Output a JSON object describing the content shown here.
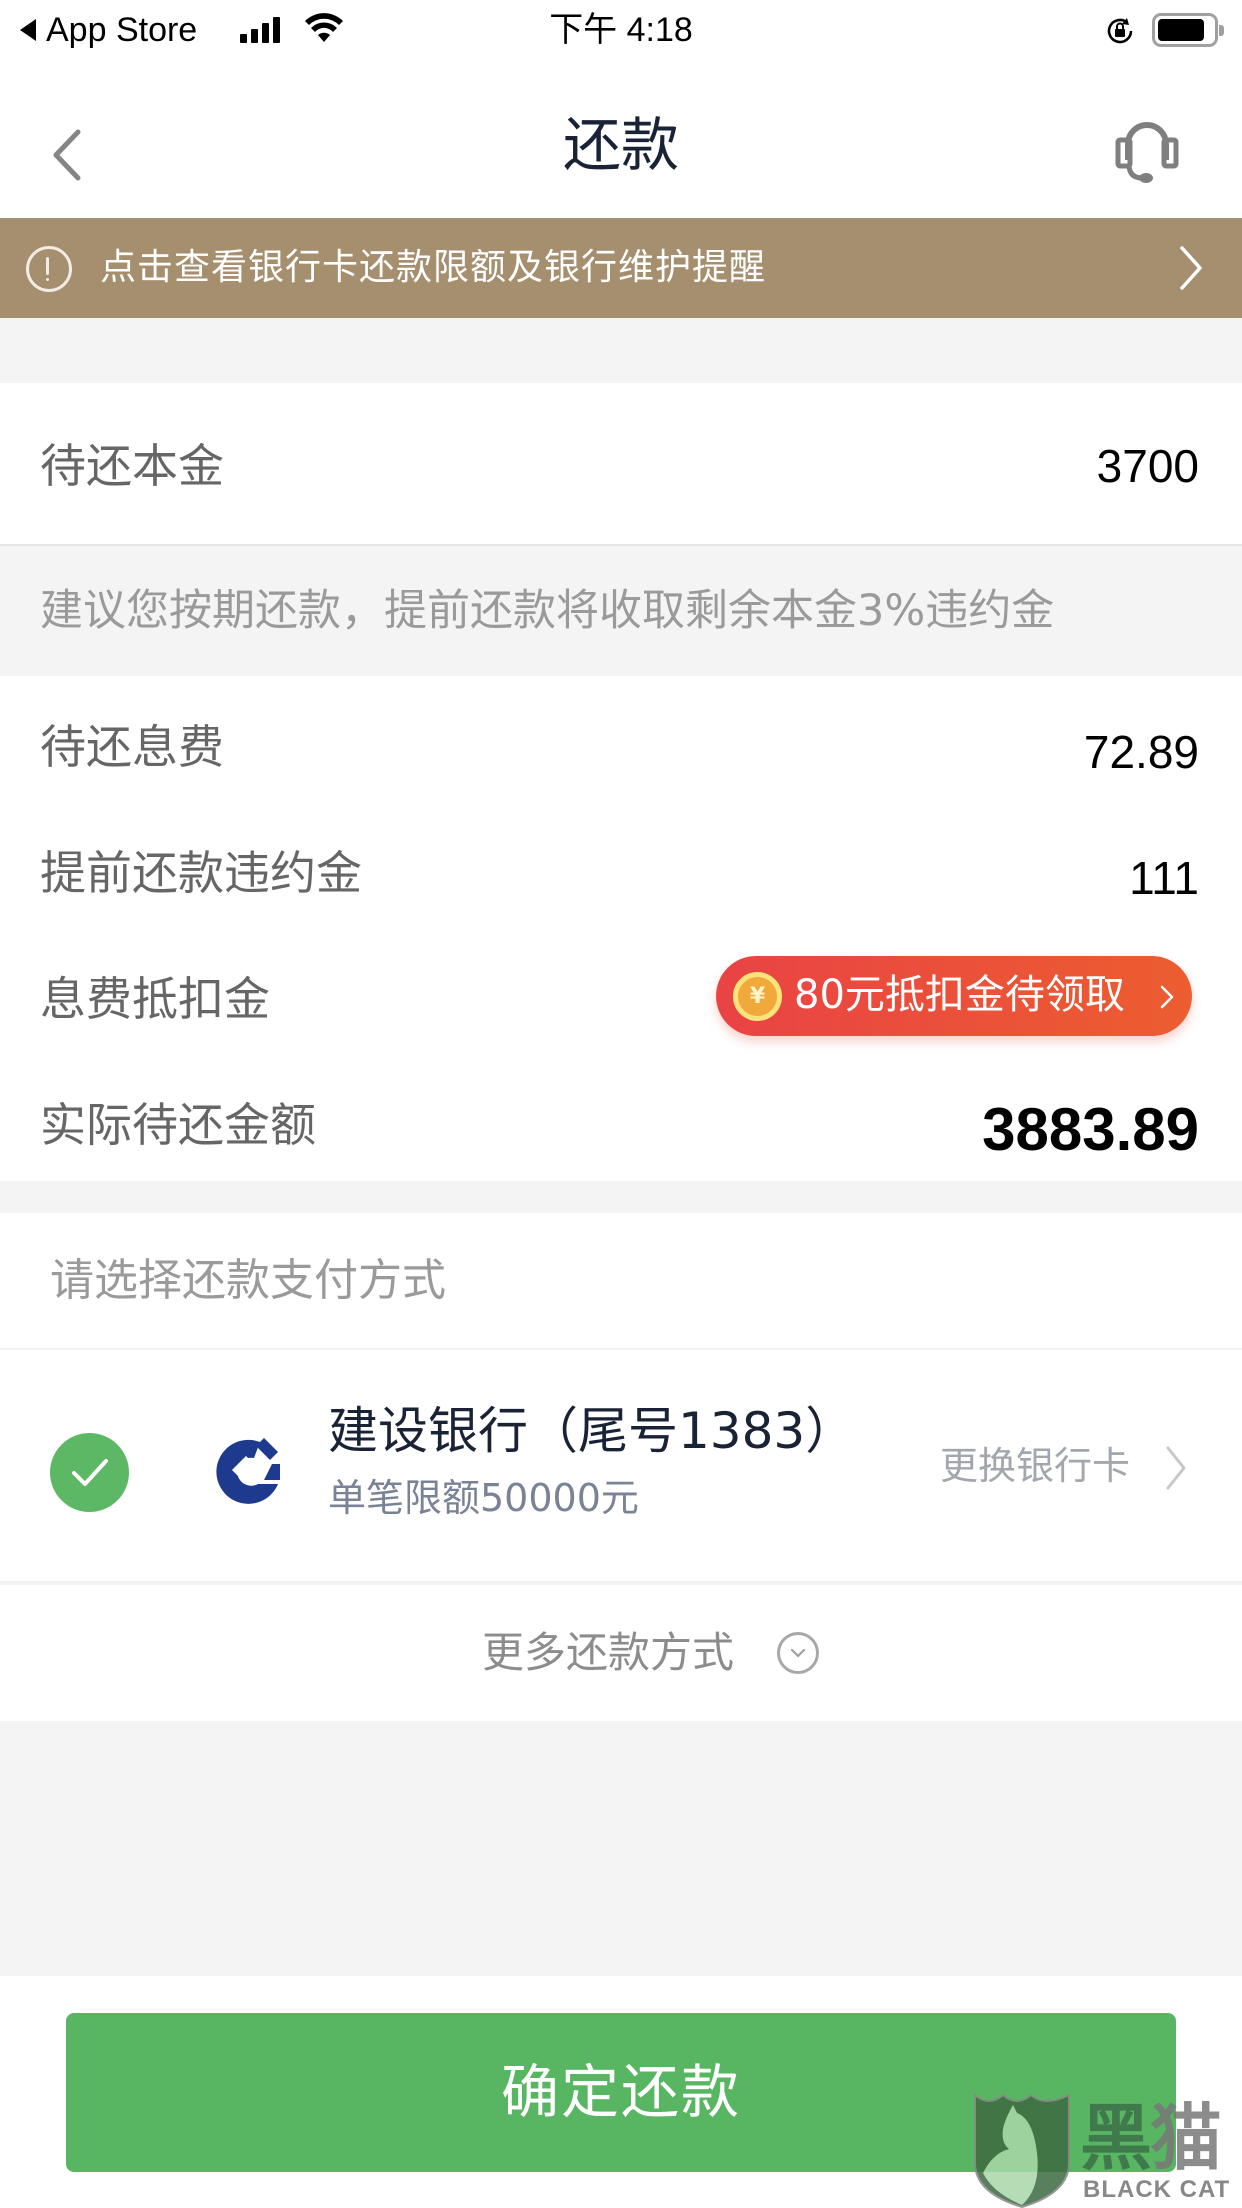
{
  "status_bar": {
    "back_app": "App Store",
    "time": "下午 4:18",
    "battery_level": 0.85
  },
  "nav": {
    "title": "还款",
    "back_icon": "chevron-left-icon",
    "service_icon": "headset-icon"
  },
  "banner": {
    "icon": "alert-circle-icon",
    "text": "点击查看银行卡还款限额及银行维护提醒"
  },
  "principal": {
    "label": "待还本金",
    "value": "3700"
  },
  "hint": "建议您按期还款，提前还款将收取剩余本金3%违约金",
  "details": [
    {
      "label": "待还息费",
      "value": "72.89"
    },
    {
      "label": "提前还款违约金",
      "value": "111"
    },
    {
      "label": "息费抵扣金",
      "coupon": {
        "coin_symbol": "¥",
        "text": "80元抵扣金待领取"
      }
    },
    {
      "label": "实际待还金额",
      "value": "3883.89"
    }
  ],
  "payment": {
    "header": "请选择还款支付方式",
    "bank": {
      "selected": true,
      "name": "建设银行（尾号1383）",
      "limit": "单笔限额50000元",
      "change_label": "更换银行卡"
    },
    "more_label": "更多还款方式"
  },
  "confirm_button": "确定还款",
  "watermark": {
    "cn_1": "黑",
    "cn_2": "猫",
    "en": "BLACK CAT"
  },
  "colors": {
    "banner": "#a68f6e",
    "primary_green": "#58b663",
    "coupon_start": "#e94344",
    "coupon_end": "#ec5d30",
    "title": "#1a2236"
  }
}
